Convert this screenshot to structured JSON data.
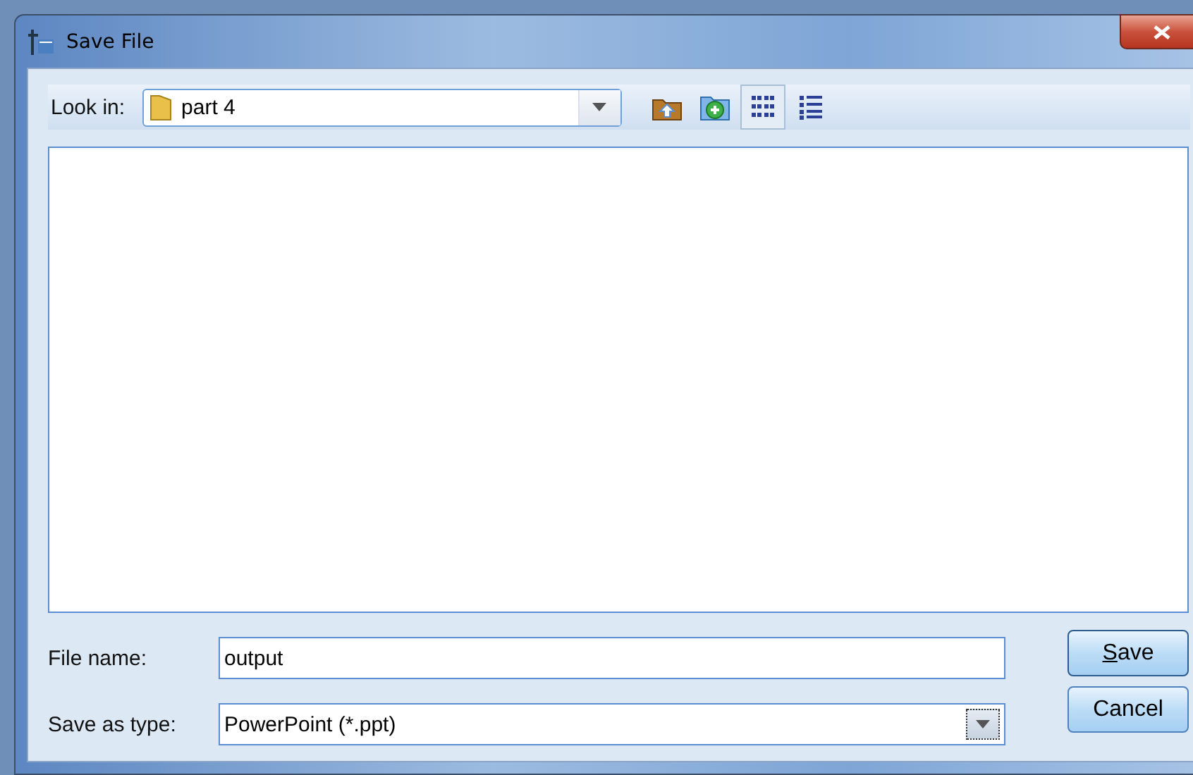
{
  "window": {
    "title": "Save File"
  },
  "toolbar": {
    "look_in_label": "Look in:",
    "folder": "part 4",
    "buttons": [
      {
        "kind": "up",
        "selected": false
      },
      {
        "kind": "new-folder",
        "selected": false
      },
      {
        "kind": "list",
        "selected": true
      },
      {
        "kind": "details",
        "selected": false
      }
    ]
  },
  "file_name": {
    "label": "File name:",
    "value": "output"
  },
  "file_type": {
    "label": "Save as type:",
    "value": "PowerPoint (*.ppt)"
  },
  "actions": [
    {
      "label": "Save",
      "default": true
    },
    {
      "label": "Cancel",
      "default": false
    }
  ]
}
